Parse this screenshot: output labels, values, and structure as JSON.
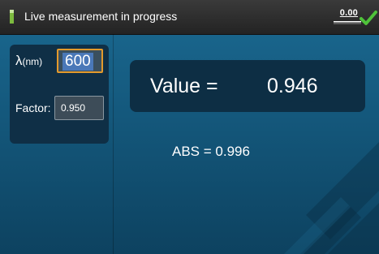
{
  "header": {
    "title": "Live measurement in progress",
    "status_value": "0.00",
    "status_icon": "checkmark-icon",
    "accent_color": "#4fc23a"
  },
  "settings": {
    "wavelength_label": "λ",
    "wavelength_unit": "(nm)",
    "wavelength_value": "600",
    "factor_label": "Factor:",
    "factor_value": "0.950"
  },
  "result": {
    "value_label": "Value =",
    "value_number": "0.946",
    "abs_label": "ABS = ",
    "abs_value": "0.996"
  }
}
